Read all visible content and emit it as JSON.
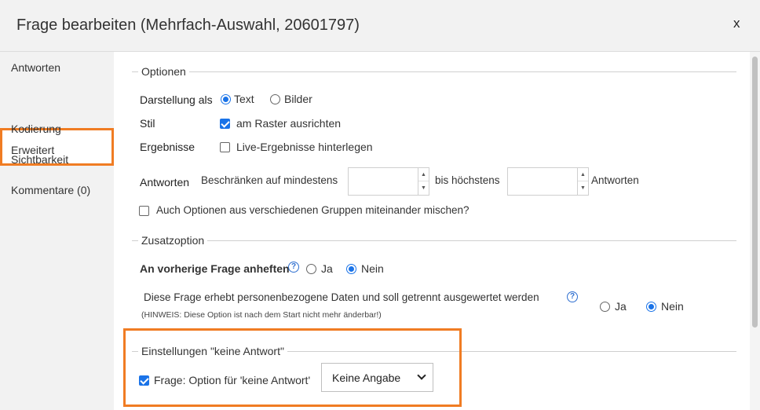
{
  "dialog": {
    "title": "Frage bearbeiten (Mehrfach-Auswahl, 20601797)",
    "close_label": "x"
  },
  "sidebar": {
    "items": [
      {
        "label": "Antworten"
      },
      {
        "label": "Erweitert",
        "active": true
      },
      {
        "label": "Kodierung"
      },
      {
        "label": "Sichtbarkeit"
      },
      {
        "label": "Kommentare (0)"
      }
    ]
  },
  "optionen": {
    "legend": "Optionen",
    "darstellung": {
      "label": "Darstellung als",
      "opt_text": "Text",
      "opt_bilder": "Bilder",
      "selected": "Text"
    },
    "stil": {
      "label": "Stil",
      "checkbox_label": "am Raster ausrichten",
      "checked": true
    },
    "ergebnisse": {
      "label": "Ergebnisse",
      "checkbox_label": "Live-Ergebnisse hinterlegen",
      "checked": false
    },
    "antworten": {
      "label": "Antworten",
      "min_text": "Beschränken auf mindestens",
      "min_value": "",
      "max_text": "bis höchstens",
      "max_value": "",
      "suffix": "Antworten"
    },
    "mischen": {
      "checkbox_label": "Auch Optionen aus verschiedenen Gruppen miteinander mischen?",
      "checked": false
    }
  },
  "zusatzoption": {
    "legend": "Zusatzoption",
    "anheften": {
      "label": "An vorherige Frage anheften",
      "help": "?",
      "opt_ja": "Ja",
      "opt_nein": "Nein",
      "selected": "Nein"
    },
    "personen": {
      "label": "Diese Frage erhebt personenbezogene Daten und soll getrennt ausgewertet werden",
      "hint": "(HINWEIS: Diese Option ist nach dem Start nicht mehr änderbar!)",
      "help": "?",
      "opt_ja": "Ja",
      "opt_nein": "Nein",
      "selected": "Nein"
    }
  },
  "keine_antwort": {
    "legend": "Einstellungen \"keine Antwort\"",
    "checkbox_label": "Frage: Option für 'keine Antwort'",
    "checked": true,
    "select_value": "Keine Angabe"
  },
  "colors": {
    "accent": "#1a73e8",
    "highlight": "#f07c23",
    "panel": "#f2f2f2"
  }
}
